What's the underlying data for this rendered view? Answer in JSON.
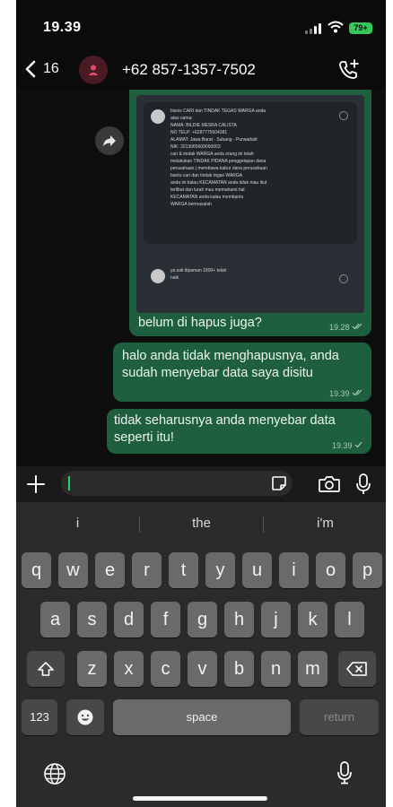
{
  "status_bar": {
    "time": "19.39",
    "battery": "79+"
  },
  "header": {
    "back_count": "16",
    "contact_name": "+62 857-1357-7502"
  },
  "messages": [
    {
      "text": "belum di hapus juga?",
      "time": "19.28",
      "forwarded_screenshot": {
        "reply1_lines": [
          "bisnis CARI dan TINDAK TEGAS WARGA anda",
          "atas nama:",
          "NAMA: BILDIE MESRA CALISTA",
          "NO TELP: +6287775604381",
          "ALAMAT: Jawa Barat - Subang - Purwadadi",
          "NIK: 3213065609050003",
          "cari & tindak WARGA anda orang ini telah",
          "melakukan TINDAK PIDANA penggelapan dana",
          "perusahaan | membawa kabur dana perusahaan",
          "bantu cari dan tindak tegas WARGA",
          "anda ini kalau KECAMATAN anda tidak mau ikut",
          "terlibat dan lurah mau memahami hal",
          "KECAMATAN anda kalau membantu",
          "WARGA bermasalah"
        ],
        "reply2_lines": [
          "ya asli dipaman 1800+ telah",
          "naik"
        ]
      }
    },
    {
      "text": "halo anda tidak menghapusnya, anda sudah menyebar data saya disitu",
      "time": "19.39"
    },
    {
      "text": "tidak seharusnya anda menyebar data seperti itu!",
      "time": "19.39"
    }
  ],
  "input": {
    "value": "",
    "placeholder": ""
  },
  "keyboard": {
    "suggestions": [
      "i",
      "the",
      "i'm"
    ],
    "row1": [
      "q",
      "w",
      "e",
      "r",
      "t",
      "y",
      "u",
      "i",
      "o",
      "p"
    ],
    "row2": [
      "a",
      "s",
      "d",
      "f",
      "g",
      "h",
      "j",
      "k",
      "l"
    ],
    "row3": [
      "z",
      "x",
      "c",
      "v",
      "b",
      "n",
      "m"
    ],
    "numbers_key": "123",
    "space_key": "space",
    "return_key": "return"
  },
  "colors": {
    "outgoing_bubble": "#1d5f3f",
    "accent": "#25d366",
    "keyboard_bg": "#2b2b2b",
    "key_bg": "#6a6a6a"
  }
}
